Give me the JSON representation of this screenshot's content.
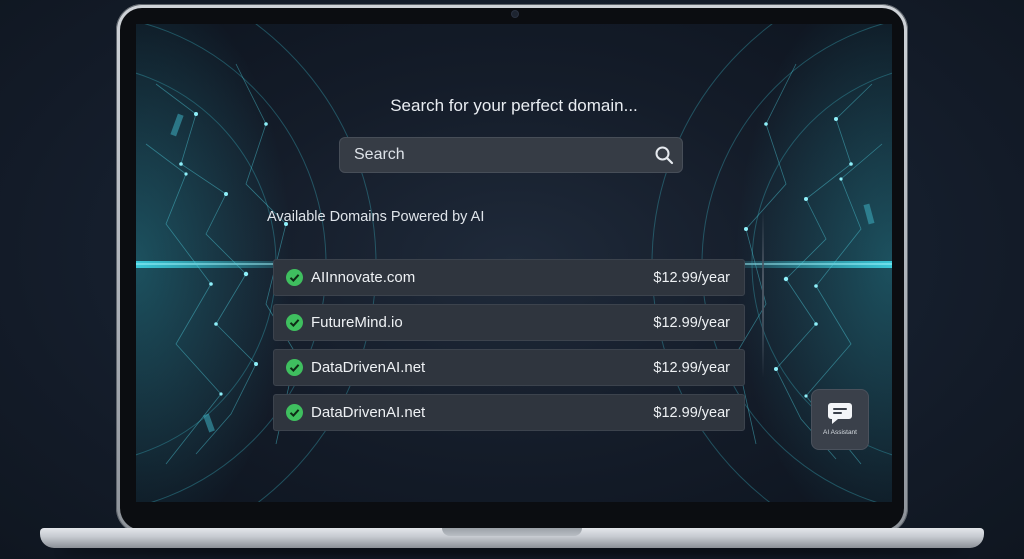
{
  "page": {
    "heading": "Search for your perfect domain...",
    "search": {
      "placeholder": "Search"
    },
    "section_title": "Available Domains Powered by AI",
    "domains": [
      {
        "name": "AIInnovate.com",
        "price": "$12.99/year",
        "status": "available"
      },
      {
        "name": "FutureMind.io",
        "price": "$12.99/year",
        "status": "available"
      },
      {
        "name": "DataDrivenAI.net",
        "price": "$12.99/year",
        "status": "available"
      },
      {
        "name": "DataDrivenAI.net",
        "price": "$12.99/year",
        "status": "available"
      }
    ],
    "assistant": {
      "label": "AI Assistant",
      "icon": "chat-bubble-icon"
    }
  },
  "colors": {
    "accent_glow": "#3fd6e6",
    "check_green": "#3fbf5f",
    "row_bg": "#2f353e",
    "search_bg": "#363c45"
  }
}
